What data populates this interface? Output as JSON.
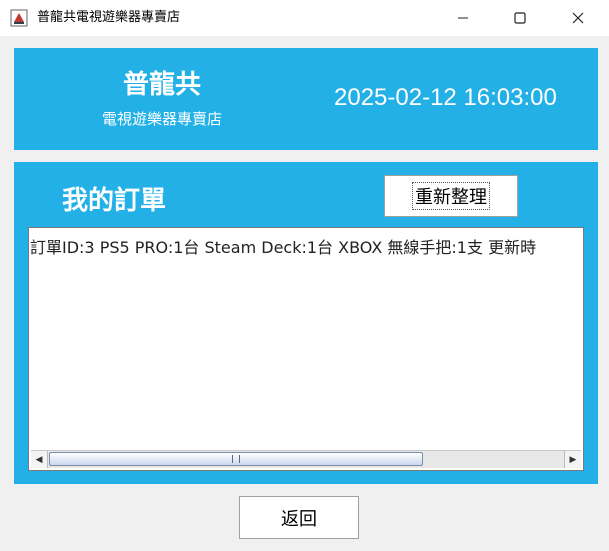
{
  "window": {
    "title": "普龍共電視遊樂器專賣店",
    "icon": "app-java-icon",
    "controls": {
      "minimize": "minimize-icon",
      "maximize": "maximize-icon",
      "close": "close-icon"
    }
  },
  "header": {
    "store_name": "普龍共",
    "store_subtitle": "電視遊樂器專賣店",
    "datetime": "2025-02-12 16:03:00"
  },
  "orders": {
    "title": "我的訂單",
    "refresh_label": "重新整理",
    "rows": [
      "訂單ID:3  PS5 PRO:1台  Steam Deck:1台  XBOX 無線手把:1支  更新時"
    ],
    "scroll_position": 0
  },
  "footer": {
    "back_label": "返回"
  },
  "colors": {
    "accent": "#22b0e6",
    "background": "#f0f0f0"
  }
}
